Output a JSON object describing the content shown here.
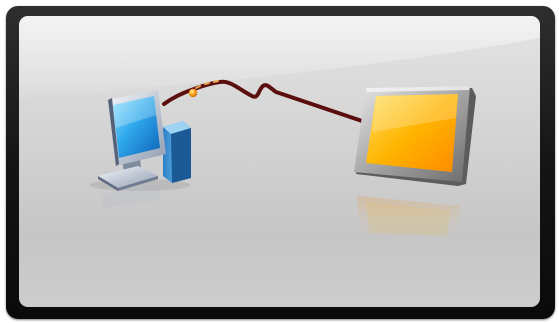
{
  "scene": {
    "devices": [
      "computer-icon",
      "tablet-icon"
    ],
    "connection": "cable",
    "colors": {
      "frame": "#1a1a1a",
      "panel": "#d4d4d4",
      "cable": "#5a0e0e",
      "monitor_screen": "#1f9be0",
      "tablet_screen": "#ffb200",
      "connector": "#ffa21a"
    }
  }
}
